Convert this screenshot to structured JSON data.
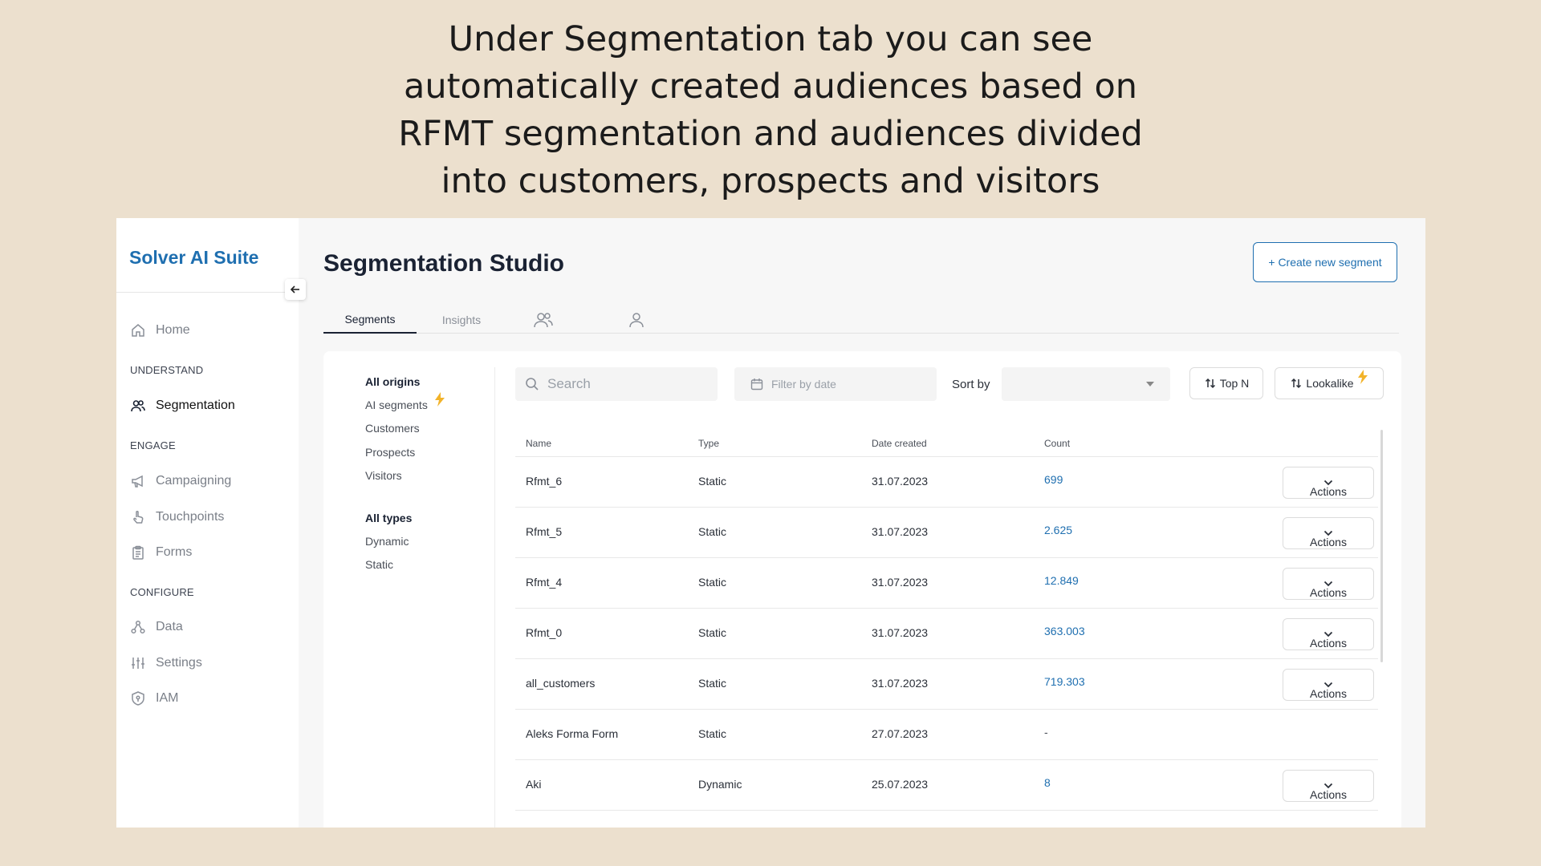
{
  "caption": {
    "lines": [
      "Under Segmentation tab you can see",
      "automatically created audiences based on",
      "RFMT segmentation and audiences divided",
      "into customers, prospects and visitors"
    ]
  },
  "app": {
    "logo": "Solver AI Suite"
  },
  "sidebar": {
    "sections": [
      "UNDERSTAND",
      "ENGAGE",
      "CONFIGURE"
    ],
    "items": [
      {
        "label": "Home",
        "icon": "home-icon"
      },
      {
        "label": "Segmentation",
        "icon": "users-icon",
        "active": true
      },
      {
        "label": "Campaigning",
        "icon": "megaphone-icon"
      },
      {
        "label": "Touchpoints",
        "icon": "pointer-hand-icon"
      },
      {
        "label": "Forms",
        "icon": "clipboard-icon"
      },
      {
        "label": "Data",
        "icon": "network-icon"
      },
      {
        "label": "Settings",
        "icon": "sliders-icon"
      },
      {
        "label": "IAM",
        "icon": "shield-icon"
      }
    ]
  },
  "header": {
    "title": "Segmentation Studio",
    "create_label": "+ Create new segment"
  },
  "tabs": [
    {
      "label": "Segments",
      "active": true
    },
    {
      "label": "Insights"
    },
    {
      "label": "",
      "icon": "users-icon"
    },
    {
      "label": "",
      "icon": "user-icon"
    }
  ],
  "filters": {
    "origins": [
      "All origins",
      "AI segments",
      "Customers",
      "Prospects",
      "Visitors"
    ],
    "types": [
      "All types",
      "Dynamic",
      "Static"
    ]
  },
  "toolbar": {
    "search_placeholder": "Search",
    "date_placeholder": "Filter by date",
    "sort_label": "Sort by",
    "sort_value": "",
    "topn_label": "Top N",
    "lookalike_label": "Lookalike"
  },
  "table": {
    "columns": [
      "Name",
      "Type",
      "Date created",
      "Count"
    ],
    "actions_label": "Actions",
    "rows": [
      {
        "name": "Rfmt_6",
        "type": "Static",
        "date": "31.07.2023",
        "count": "699",
        "has_actions": true
      },
      {
        "name": "Rfmt_5",
        "type": "Static",
        "date": "31.07.2023",
        "count": "2.625",
        "has_actions": true
      },
      {
        "name": "Rfmt_4",
        "type": "Static",
        "date": "31.07.2023",
        "count": "12.849",
        "has_actions": true
      },
      {
        "name": "Rfmt_0",
        "type": "Static",
        "date": "31.07.2023",
        "count": "363.003",
        "has_actions": true
      },
      {
        "name": "all_customers",
        "type": "Static",
        "date": "31.07.2023",
        "count": "719.303",
        "has_actions": true
      },
      {
        "name": "Aleks Forma Form",
        "type": "Static",
        "date": "27.07.2023",
        "count": "-",
        "has_actions": false
      },
      {
        "name": "Aki",
        "type": "Dynamic",
        "date": "25.07.2023",
        "count": "8",
        "has_actions": true
      }
    ]
  },
  "colors": {
    "accent": "#1f6fb0",
    "bolt": "#f2b32a",
    "background": "#ece0ce"
  }
}
